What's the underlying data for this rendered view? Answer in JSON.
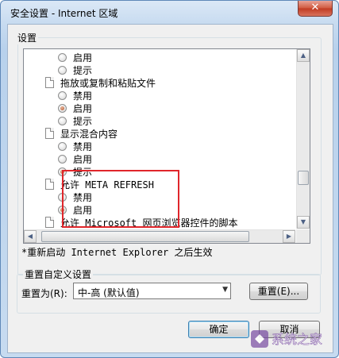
{
  "window": {
    "title": "安全设置 - Internet 区域",
    "close": "✕"
  },
  "settings": {
    "group_label": "设置",
    "items": [
      {
        "kind": "radio",
        "label": "启用",
        "checked": false,
        "indent": 1
      },
      {
        "kind": "radio",
        "label": "提示",
        "checked": false,
        "indent": 1
      },
      {
        "kind": "heading",
        "label": "拖放或复制和粘贴文件",
        "indent": 0
      },
      {
        "kind": "radio",
        "label": "禁用",
        "checked": false,
        "indent": 1
      },
      {
        "kind": "radio",
        "label": "启用",
        "checked": true,
        "indent": 1
      },
      {
        "kind": "radio",
        "label": "提示",
        "checked": false,
        "indent": 1
      },
      {
        "kind": "heading",
        "label": "显示混合内容",
        "indent": 0
      },
      {
        "kind": "radio",
        "label": "禁用",
        "checked": false,
        "indent": 1
      },
      {
        "kind": "radio",
        "label": "启用",
        "checked": false,
        "indent": 1
      },
      {
        "kind": "radio",
        "label": "提示",
        "checked": true,
        "indent": 1
      },
      {
        "kind": "heading",
        "label": "允许 META REFRESH",
        "indent": 0
      },
      {
        "kind": "radio",
        "label": "禁用",
        "checked": false,
        "indent": 1
      },
      {
        "kind": "radio",
        "label": "启用",
        "checked": true,
        "indent": 1
      },
      {
        "kind": "heading",
        "label": "允许 Microsoft 网页浏览器控件的脚本",
        "indent": 0
      }
    ],
    "note": "*重新启动 Internet Explorer 之后生效"
  },
  "reset": {
    "group_label": "重置自定义设置",
    "label": "重置为(R):",
    "selected": "中-高 (默认值)",
    "button": "重置(E)..."
  },
  "footer": {
    "ok": "确定",
    "cancel": "取消"
  },
  "icons": {
    "up": "▲",
    "down": "▼",
    "left": "◀",
    "right": "▶",
    "combo_arrow": "▼"
  },
  "watermark": {
    "text": "系统之家"
  }
}
